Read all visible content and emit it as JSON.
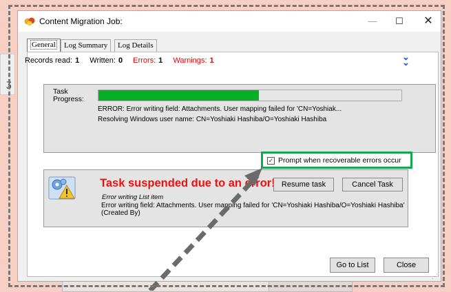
{
  "window": {
    "title": "Content Migration Job:",
    "minimize_glyph": "—",
    "maximize_glyph": "☐",
    "close_glyph": "✕"
  },
  "tabs": [
    {
      "label": "General",
      "selected": true
    },
    {
      "label": "Log Summary",
      "selected": false
    },
    {
      "label": "Log Details",
      "selected": false
    }
  ],
  "stats": {
    "records_read_label": "Records read:",
    "records_read_value": "1",
    "written_label": "Written:",
    "written_value": "0",
    "errors_label": "Errors:",
    "errors_value": "1",
    "warnings_label": "Warnings:",
    "warnings_value": "1",
    "expand_icon": "double-chevron-down-icon"
  },
  "task": {
    "label": "Task Progress:",
    "progress_fraction": 0.53,
    "line1": "ERROR: Error writing field: Attachments.  User mapping failed for 'CN=Yoshiak...",
    "line2": "Resolving Windows user name: CN=Yoshiaki Hashiba/O=Yoshiaki Hashiba"
  },
  "prompt": {
    "label": "Prompt when recoverable errors occur",
    "checked": true
  },
  "error_panel": {
    "title": "Task suspended due to an error!",
    "resume_label": "Resume task",
    "cancel_label": "Cancel Task",
    "subtitle": "Error writing List item",
    "message": "Error writing field: Attachments.  User mapping failed for 'CN=Yoshiaki Hashiba/O=Yoshiaki Hashiba' (Created By)"
  },
  "footer": {
    "go_to_list_label": "Go to List",
    "close_label": "Close"
  },
  "colors": {
    "progress": "#06b025",
    "error_text": "#e11111",
    "highlight": "#12a84d",
    "background": "#f7cfc3"
  }
}
